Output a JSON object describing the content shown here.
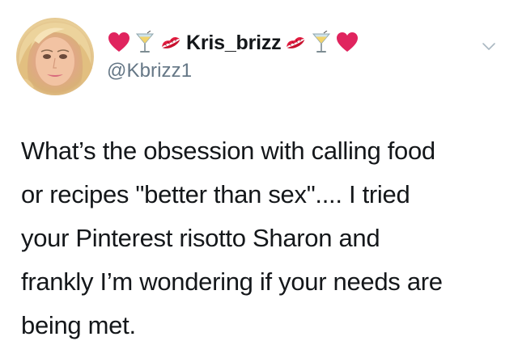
{
  "tweet": {
    "display_name": "Kris_brizz",
    "handle": "@Kbrizz1",
    "name_emojis_left": [
      "heart-icon",
      "cocktail-glass-icon",
      "kiss-mark-icon"
    ],
    "name_emojis_right": [
      "kiss-mark-icon",
      "cocktail-glass-icon",
      "heart-icon"
    ],
    "text": "What’s the obsession with calling food\nor recipes \"better than sex\".... I tried\nyour Pinterest risotto Sharon and\nfrankly I’m wondering if your needs are\nbeing met.",
    "menu_icon": "chevron-down-icon"
  },
  "colors": {
    "text": "#14171a",
    "handle": "#657786",
    "heart": "#e0245e",
    "kiss": "#e31b3f",
    "chevron": "#aab8c2"
  }
}
